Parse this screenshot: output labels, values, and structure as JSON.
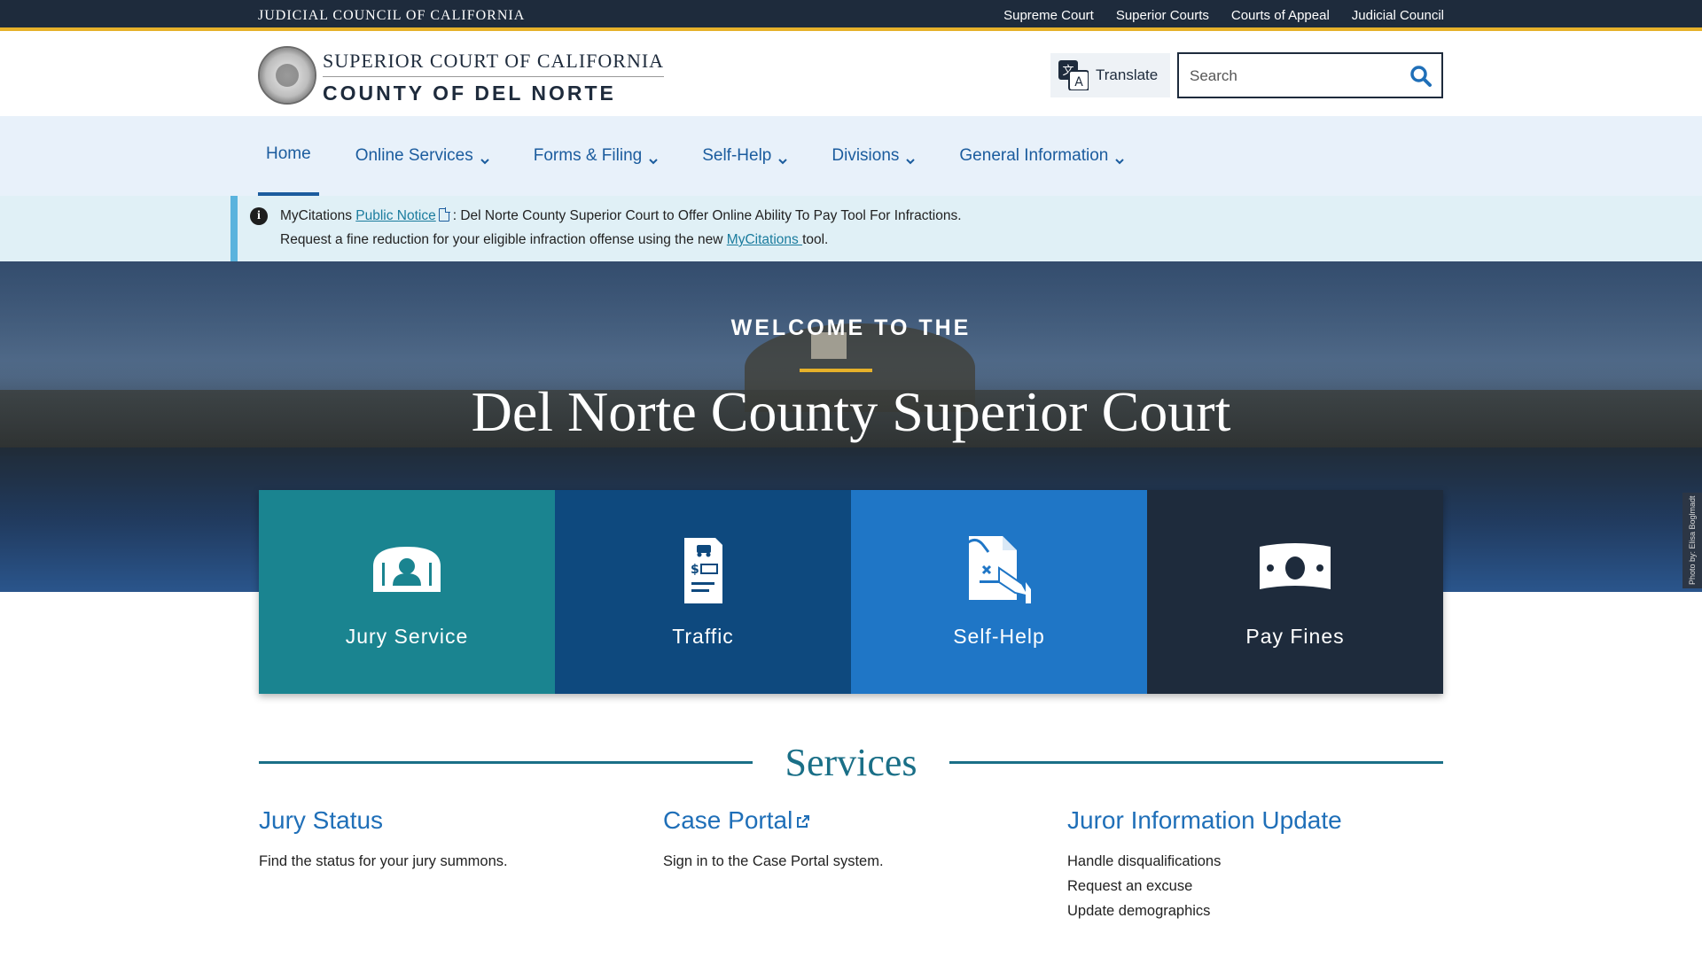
{
  "topbar": {
    "brand": "Judicial Council of California",
    "links": [
      "Supreme Court",
      "Superior Courts",
      "Courts of Appeal",
      "Judicial Council"
    ]
  },
  "header": {
    "court_line1": "SUPERIOR COURT OF CALIFORNIA",
    "court_line2": "COUNTY OF DEL NORTE",
    "translate_label": "Translate",
    "search_placeholder": "Search"
  },
  "nav": {
    "items": [
      "Home",
      "Online Services",
      "Forms & Filing",
      "Self-Help",
      "Divisions",
      "General Information"
    ]
  },
  "alert": {
    "line1_prefix": "MyCitations ",
    "line1_link": "Public Notice",
    "line1_suffix": ": Del Norte County Superior Court to Offer Online Ability To Pay Tool For Infractions.",
    "line2_prefix": "Request a fine reduction for your eligible infraction offense using the new ",
    "line2_link": "MyCitations ",
    "line2_suffix": "tool."
  },
  "hero": {
    "welcome": "WELCOME TO THE",
    "title": "Del Norte County Superior Court",
    "photo_credit": "Photo by: Elisa Boglmadt"
  },
  "tiles": [
    {
      "label": "Jury Service",
      "icon": "juror-icon",
      "color": "#1a8490"
    },
    {
      "label": "Traffic",
      "icon": "traffic-ticket-icon",
      "color": "#0e497e"
    },
    {
      "label": "Self-Help",
      "icon": "self-help-document-icon",
      "color": "#1f76c6"
    },
    {
      "label": "Pay Fines",
      "icon": "money-bill-icon",
      "color": "#1e2b3c"
    }
  ],
  "services": {
    "title": "Services",
    "items": [
      {
        "title": "Jury Status",
        "lines": [
          "Find the status for your jury summons."
        ]
      },
      {
        "title": "Case Portal",
        "lines": [
          "Sign in to the Case Portal system."
        ]
      },
      {
        "title": "Juror Information Update",
        "lines": [
          "Handle disqualifications",
          "Request an excuse",
          "Update demographics"
        ]
      }
    ]
  },
  "colors": {
    "navy": "#1e2b3c",
    "gold": "#e6b12a",
    "link_blue": "#1b5c9e",
    "teal": "#1a6f87"
  }
}
